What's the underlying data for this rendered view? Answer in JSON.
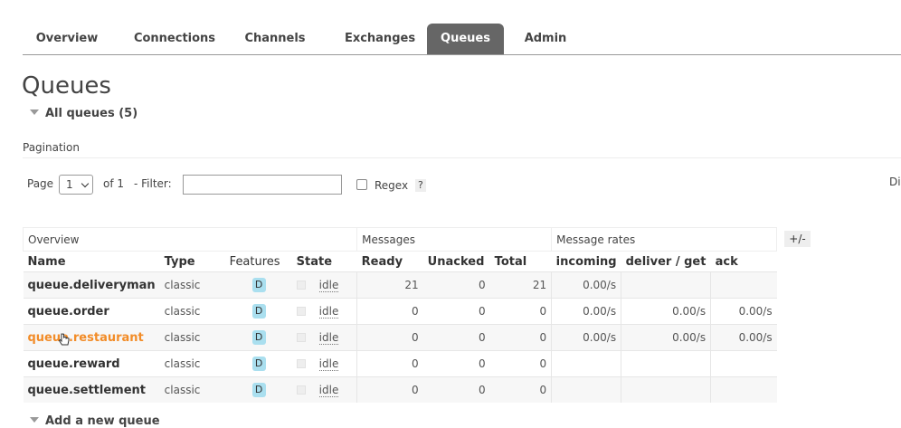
{
  "nav": {
    "tabs": [
      {
        "label": "Overview"
      },
      {
        "label": "Connections"
      },
      {
        "label": "Channels"
      },
      {
        "label": "Exchanges"
      },
      {
        "label": "Queues"
      },
      {
        "label": "Admin"
      }
    ],
    "active": "Queues"
  },
  "page": {
    "title": "Queues",
    "all_queues_label": "All queues (5)",
    "pagination_label": "Pagination",
    "add_queue_label": "Add a new queue"
  },
  "pager": {
    "page_label": "Page",
    "page_value": "1",
    "of_label": "of 1",
    "filter_label": "- Filter:",
    "filter_value": "",
    "regex_label": "Regex",
    "help_label": "?",
    "right_clip": "Di"
  },
  "table": {
    "groups": [
      "Overview",
      "Messages",
      "Message rates"
    ],
    "plusminus": "+/-",
    "headers": [
      "Name",
      "Type",
      "Features",
      "State",
      "Ready",
      "Unacked",
      "Total",
      "incoming",
      "deliver / get",
      "ack"
    ],
    "rows": [
      {
        "name": "queue.deliveryman",
        "type": "classic",
        "feature": "D",
        "state": "idle",
        "ready": "21",
        "unacked": "0",
        "total": "21",
        "incoming": "0.00/s",
        "deliver": "",
        "ack": ""
      },
      {
        "name": "queue.order",
        "type": "classic",
        "feature": "D",
        "state": "idle",
        "ready": "0",
        "unacked": "0",
        "total": "0",
        "incoming": "0.00/s",
        "deliver": "0.00/s",
        "ack": "0.00/s"
      },
      {
        "name": "queue.restaurant",
        "type": "classic",
        "feature": "D",
        "state": "idle",
        "ready": "0",
        "unacked": "0",
        "total": "0",
        "incoming": "0.00/s",
        "deliver": "0.00/s",
        "ack": "0.00/s"
      },
      {
        "name": "queue.reward",
        "type": "classic",
        "feature": "D",
        "state": "idle",
        "ready": "0",
        "unacked": "0",
        "total": "0",
        "incoming": "",
        "deliver": "",
        "ack": ""
      },
      {
        "name": "queue.settlement",
        "type": "classic",
        "feature": "D",
        "state": "idle",
        "ready": "0",
        "unacked": "0",
        "total": "0",
        "incoming": "",
        "deliver": "",
        "ack": ""
      }
    ]
  },
  "colors": {
    "active_tab": "#666666",
    "hover_link": "#f28c28",
    "feature_badge": "#aadfef"
  }
}
